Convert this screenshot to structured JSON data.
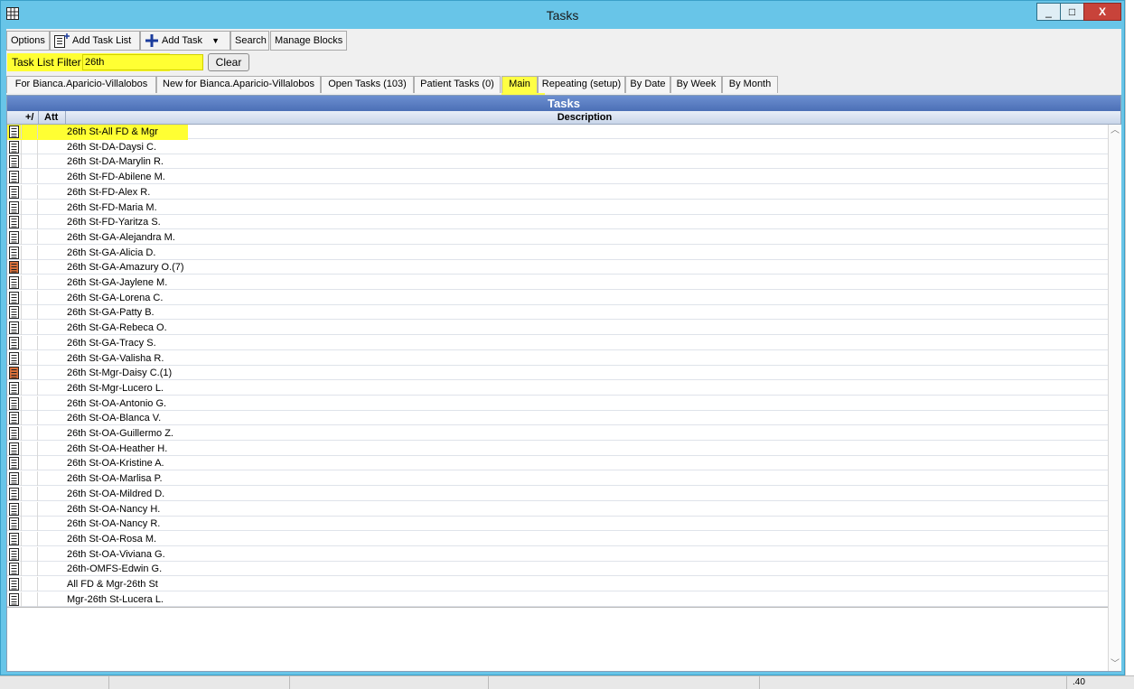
{
  "window": {
    "title": "Tasks",
    "minimize_label": "_",
    "maximize_label": "□",
    "close_label": "X"
  },
  "toolbar": {
    "options": "Options",
    "add_task_list": "Add Task List",
    "add_task": "Add Task",
    "add_task_dropdown": "▼",
    "search": "Search",
    "manage_blocks": "Manage Blocks"
  },
  "filter": {
    "label": "Task List Filter",
    "value": "26th",
    "clear": "Clear"
  },
  "tabs": [
    {
      "label": "For Bianca.Aparicio-Villalobos"
    },
    {
      "label": "New for Bianca.Aparicio-Villalobos"
    },
    {
      "label": "Open Tasks (103)"
    },
    {
      "label": "Patient Tasks (0)"
    },
    {
      "label": "Main"
    },
    {
      "label": "Repeating (setup)"
    },
    {
      "label": "By Date"
    },
    {
      "label": "By Week"
    },
    {
      "label": "By Month"
    }
  ],
  "active_tab": "Main",
  "grid": {
    "title": "Tasks",
    "columns": {
      "expand": "+/",
      "att": "Att",
      "description": "Description"
    },
    "rows": [
      {
        "description": "26th St-All FD & Mgr",
        "icon": "task-list-icon",
        "highlighted": true
      },
      {
        "description": "26th St-DA-Daysi C.",
        "icon": "task-list-icon"
      },
      {
        "description": "26th St-DA-Marylin R.",
        "icon": "task-list-icon"
      },
      {
        "description": "26th St-FD-Abilene M.",
        "icon": "task-list-icon"
      },
      {
        "description": "26th St-FD-Alex R.",
        "icon": "task-list-icon"
      },
      {
        "description": "26th St-FD-Maria M.",
        "icon": "task-list-icon"
      },
      {
        "description": "26th St-FD-Yaritza S.",
        "icon": "task-list-icon"
      },
      {
        "description": "26th St-GA-Alejandra M.",
        "icon": "task-list-icon"
      },
      {
        "description": "26th St-GA-Alicia D.",
        "icon": "task-list-icon"
      },
      {
        "description": "26th St-GA-Amazury O.(7)",
        "icon": "task-list-pending-icon"
      },
      {
        "description": "26th St-GA-Jaylene M.",
        "icon": "task-list-icon"
      },
      {
        "description": "26th St-GA-Lorena C.",
        "icon": "task-list-icon"
      },
      {
        "description": "26th St-GA-Patty B.",
        "icon": "task-list-icon"
      },
      {
        "description": "26th St-GA-Rebeca O.",
        "icon": "task-list-icon"
      },
      {
        "description": "26th St-GA-Tracy S.",
        "icon": "task-list-icon"
      },
      {
        "description": "26th St-GA-Valisha R.",
        "icon": "task-list-icon"
      },
      {
        "description": "26th St-Mgr-Daisy C.(1)",
        "icon": "task-list-pending-icon"
      },
      {
        "description": "26th St-Mgr-Lucero L.",
        "icon": "task-list-icon"
      },
      {
        "description": "26th St-OA-Antonio G.",
        "icon": "task-list-icon"
      },
      {
        "description": "26th St-OA-Blanca V.",
        "icon": "task-list-icon"
      },
      {
        "description": "26th St-OA-Guillermo Z.",
        "icon": "task-list-icon"
      },
      {
        "description": "26th St-OA-Heather H.",
        "icon": "task-list-icon"
      },
      {
        "description": "26th St-OA-Kristine A.",
        "icon": "task-list-icon"
      },
      {
        "description": "26th St-OA-Marlisa P.",
        "icon": "task-list-icon"
      },
      {
        "description": "26th St-OA-Mildred D.",
        "icon": "task-list-icon"
      },
      {
        "description": "26th St-OA-Nancy H.",
        "icon": "task-list-icon"
      },
      {
        "description": "26th St-OA-Nancy R.",
        "icon": "task-list-icon"
      },
      {
        "description": "26th St-OA-Rosa M.",
        "icon": "task-list-icon"
      },
      {
        "description": "26th St-OA-Viviana G.",
        "icon": "task-list-icon"
      },
      {
        "description": "26th-OMFS-Edwin G.",
        "icon": "task-list-icon"
      },
      {
        "description": "All FD & Mgr-26th St",
        "icon": "task-list-icon"
      },
      {
        "description": "Mgr-26th St-Lucera L.",
        "icon": "task-list-icon"
      }
    ]
  },
  "colors": {
    "window_frame": "#68c5e8",
    "highlight": "#ffff33",
    "grid_title": "#4b6fb6",
    "pending_icon": "#d9703a"
  },
  "status": {
    "corner_value": ".40"
  }
}
